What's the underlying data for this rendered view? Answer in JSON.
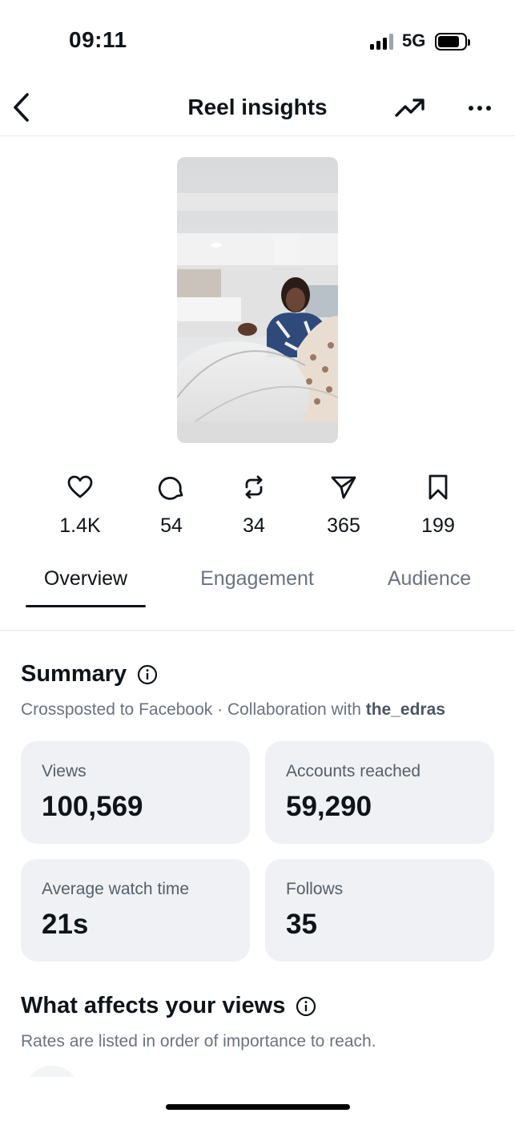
{
  "status_bar": {
    "time": "09:11",
    "network": "5G"
  },
  "header": {
    "title": "Reel insights"
  },
  "stats": [
    {
      "icon": "heart-icon",
      "value": "1.4K"
    },
    {
      "icon": "comment-icon",
      "value": "54"
    },
    {
      "icon": "repost-icon",
      "value": "34"
    },
    {
      "icon": "share-icon",
      "value": "365"
    },
    {
      "icon": "bookmark-icon",
      "value": "199"
    }
  ],
  "tabs": [
    {
      "label": "Overview",
      "active": true
    },
    {
      "label": "Engagement",
      "active": false
    },
    {
      "label": "Audience",
      "active": false
    }
  ],
  "summary": {
    "title": "Summary",
    "crosspost": "Crossposted to Facebook · Collaboration with ",
    "collaborator": "the_edras",
    "cards": [
      {
        "label": "Views",
        "value": "100,569"
      },
      {
        "label": "Accounts reached",
        "value": "59,290"
      },
      {
        "label": "Average watch time",
        "value": "21s"
      },
      {
        "label": "Follows",
        "value": "35"
      }
    ]
  },
  "affects": {
    "title": "What affects your views",
    "subtitle": "Rates are listed in order of importance to reach."
  }
}
